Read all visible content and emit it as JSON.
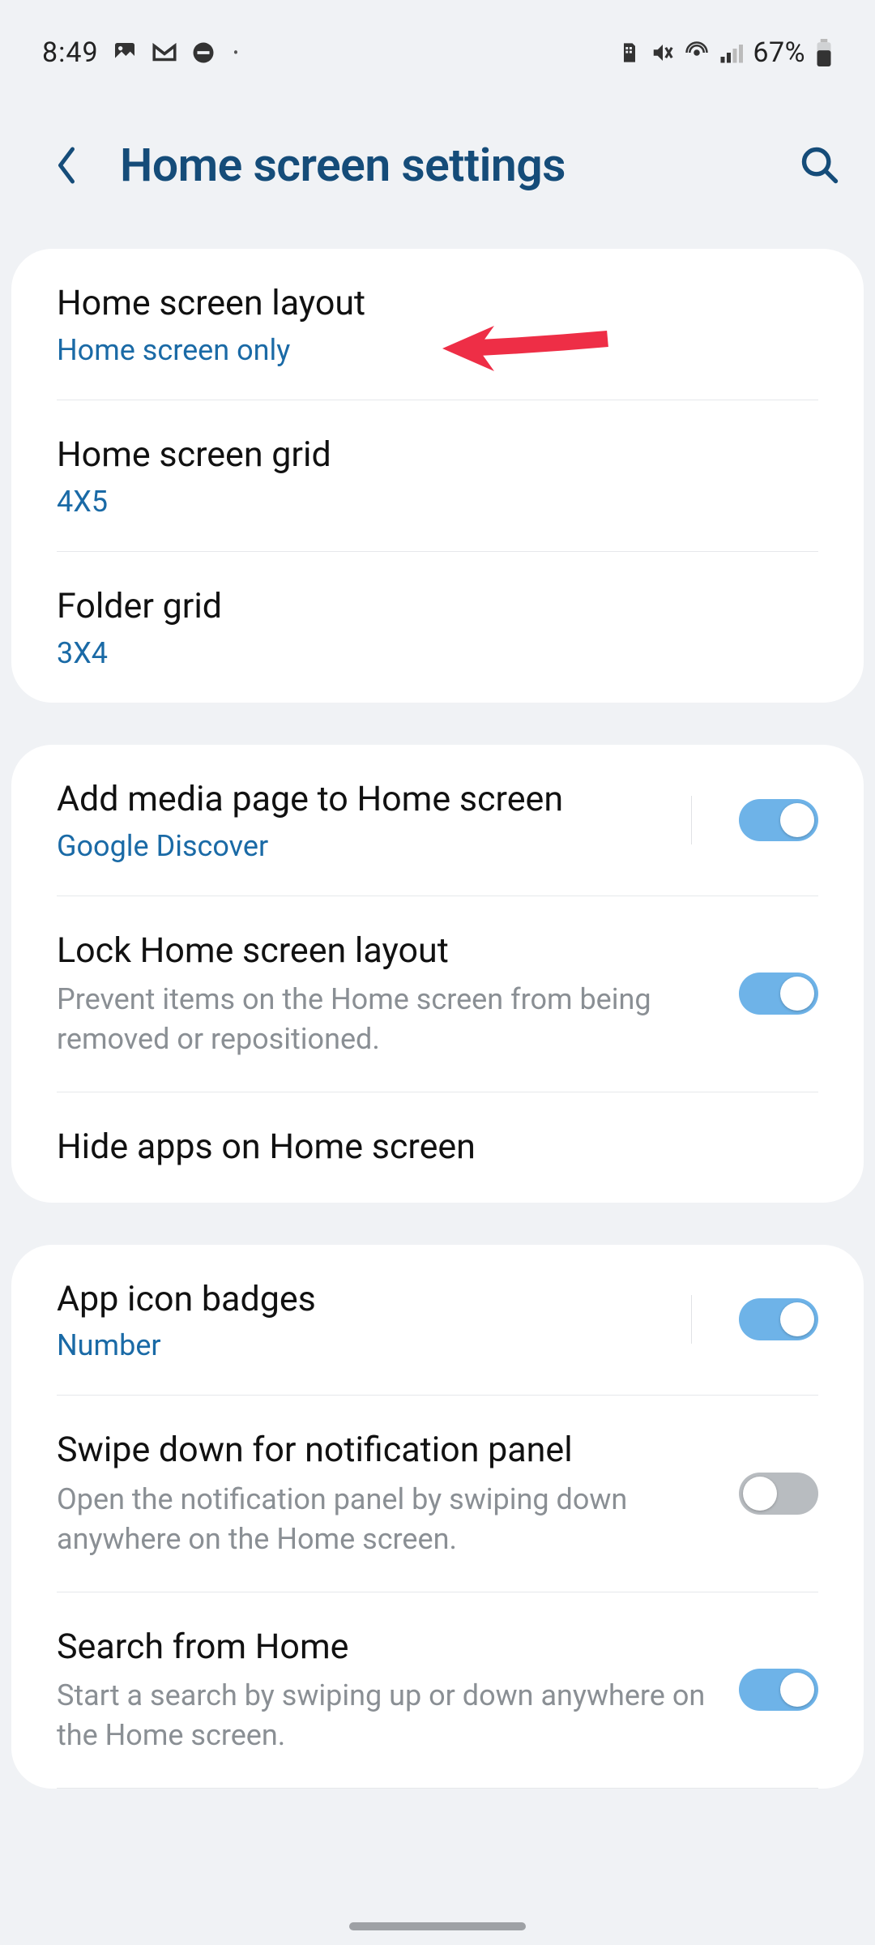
{
  "status": {
    "time": "8:49",
    "battery_text": "67%"
  },
  "header": {
    "title": "Home screen settings"
  },
  "section1": {
    "layout": {
      "title": "Home screen layout",
      "sub": "Home screen only"
    },
    "grid": {
      "title": "Home screen grid",
      "sub": "4X5"
    },
    "folder": {
      "title": "Folder grid",
      "sub": "3X4"
    }
  },
  "section2": {
    "media": {
      "title": "Add media page to Home screen",
      "sub": "Google Discover",
      "on": true
    },
    "lock": {
      "title": "Lock Home screen layout",
      "desc": "Prevent items on the Home screen from being removed or repositioned.",
      "on": true
    },
    "hide": {
      "title": "Hide apps on Home screen"
    }
  },
  "section3": {
    "badges": {
      "title": "App icon badges",
      "sub": "Number",
      "on": true
    },
    "swipe": {
      "title": "Swipe down for notification panel",
      "desc": "Open the notification panel by swiping down anywhere on the Home screen.",
      "on": false
    },
    "search": {
      "title": "Search from Home",
      "desc": "Start a search by swiping up or down anywhere on the Home screen.",
      "on": true
    }
  }
}
